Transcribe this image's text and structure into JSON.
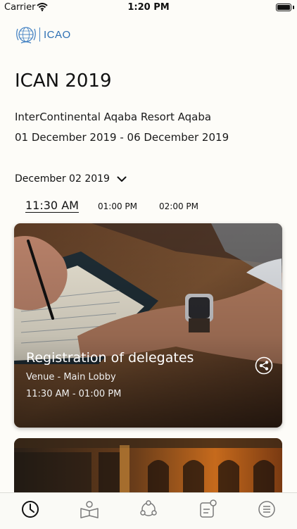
{
  "status_bar": {
    "carrier": "Carrier",
    "time": "1:20 PM"
  },
  "logo": {
    "text": "ICAO"
  },
  "event": {
    "title": "ICAN 2019",
    "venue": "InterContinental Aqaba Resort Aqaba",
    "dates": "01 December 2019 - 06 December 2019"
  },
  "date_select": {
    "value": "December 02 2019"
  },
  "time_tabs": [
    "11:30 AM",
    "01:00 PM",
    "02:00 PM"
  ],
  "session": {
    "title": "Registration of delegates",
    "venue": "Venue - Main Lobby",
    "time": "11:30 AM - 01:00 PM"
  },
  "tabs": [
    {
      "icon": "clock-icon"
    },
    {
      "icon": "reader-icon"
    },
    {
      "icon": "network-icon"
    },
    {
      "icon": "notes-icon"
    },
    {
      "icon": "menu-icon"
    }
  ],
  "colors": {
    "accent": "#2c6fb3",
    "background": "#fdfcf8",
    "tab_icon": "#7a7a7a"
  }
}
